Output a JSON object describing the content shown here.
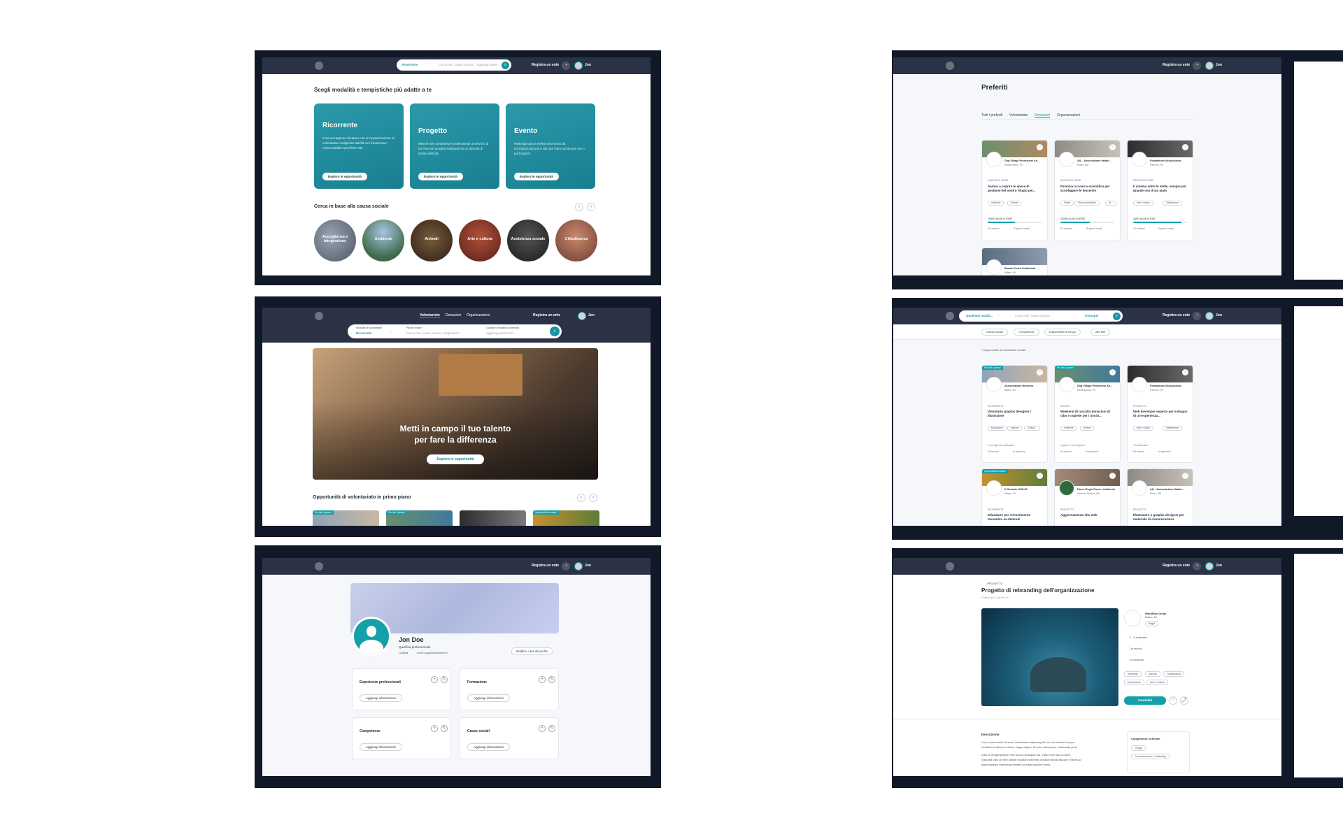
{
  "nav": {
    "register_label": "Registra un ente",
    "user_name": "Jon",
    "chevron": "⌄",
    "bell_icon": "bell-icon",
    "search_icon": "search-icon"
  },
  "screen1": {
    "search": {
      "select_value": "Ricorrente",
      "cause_placeholder": "Cerca enti, cause sociali...",
      "where_placeholder": "Aggiungi prefer..."
    },
    "heading": "Scegli modalità e tempistiche più adatte a te",
    "cards": [
      {
        "title": "Ricorrente",
        "desc": "Crea un rapporto duraturo con un'organizzazione di volontariato svolgendo attività con frequenza e responsabilità specifiche alla",
        "button": "Esplora le opportunità"
      },
      {
        "title": "Progetto",
        "desc": "Metti le tue competenze professionali al servizio di un ente per progetti sviluppati su un periodo di durata definita",
        "button": "Esplora le opportunità"
      },
      {
        "title": "Evento",
        "desc": "Partecipa ad un evento promosso da un'organizzazione e dai una mano ad alcune ore o pochi giorni",
        "button": "Esplora le opportunità"
      }
    ],
    "causes_heading": "Cerca in base alla causa sociale",
    "causes": [
      "Accoglienza e integrazione",
      "Ambiente",
      "Animali",
      "Arte e cultura",
      "Assistenza sociale",
      "Cittadinanza"
    ],
    "prev": "‹",
    "next": "›"
  },
  "screen2": {
    "title": "Preferiti",
    "tabs": [
      "Tutti i preferiti",
      "Volontariato",
      "Donazioni",
      "Organizzazioni"
    ],
    "cards": [
      {
        "org": "Dog Village Protezione An...",
        "loc": "Montesilvano, PE",
        "type": "RACCOLTA FONDI",
        "title": "Aiutaci a coprire le spese di gestione del nostro rifugio per...",
        "tags": [
          "Ambiente",
          "Animali"
        ],
        "amount": "1500€ raccolti di 2000€",
        "progress": 0.5,
        "donors": "23 donatori",
        "days": "12 giorni rimasti"
      },
      {
        "org": "AIL - Associazione Italian...",
        "loc": "Roma, RM",
        "type": "RACCOLTA FONDI",
        "title": "Finanzia la ricerca scientifica per sconfiggere le leucemie",
        "tags": [
          "Salute",
          "Ricerca scientifica",
          "Al..."
        ],
        "amount": "4000€ raccolti di 8000€",
        "progress": 0.55,
        "donors": "83 donatori",
        "days": "18 giorni rimasti"
      },
      {
        "org": "Fondazione Associazion...",
        "loc": "Palermo, PA",
        "type": "RACCOLTA FONDI",
        "title": "Il cinema sotto le stelle, sempre più grande con il tuo aiuto",
        "tags": [
          "Arte e cultura",
          "Cittadinanza"
        ],
        "amount": "450€ raccolti di 500€",
        "progress": 0.9,
        "donors": "14 donatori",
        "days": "5 giorni rimasti"
      },
      {
        "org": "Banda Civica Solidarietà",
        "loc": "Milano, MI"
      }
    ]
  },
  "screen3": {
    "tabs": [
      "Volontariato",
      "Donazioni",
      "Organizzazioni"
    ],
    "search": {
      "mode_label": "Modalità di volontariato",
      "mode_value": "Ricorrente",
      "keyword_label": "Parole chiave",
      "keyword_placeholder": "Cerca enti, cause sociali, competenze",
      "where_label": "Località o modalità da remoto",
      "where_placeholder": "Aggiungi preferenze"
    },
    "hero_title_line1": "Metti in campo il tuo talento",
    "hero_title_line2": "per fare la differenza",
    "hero_button": "Esplora le opportunità",
    "featured_heading": "Opportunità di volontariato in primo piano",
    "badges": [
      "Per tutti i giovani",
      "Per tutti i giovani",
      "",
      "Opportunità formative"
    ]
  },
  "screen4": {
    "search": {
      "mode": "Qualsiasi modal...",
      "keyword": "Cerca enti, cause sociali...",
      "where": "Ovunque"
    },
    "filters": [
      "Causa sociali",
      "Competenze",
      "Disponibilità di tempo",
      "Altri filtri"
    ],
    "count": "7 Opportunità di volontariato trovate",
    "cards": [
      {
        "badge": "Per tutti i giovani",
        "org": "Associazione Mercurio",
        "loc": "Milano, MI",
        "type": "RICORRENTE",
        "title": "Volontario graphic designer / illustratore",
        "tags": [
          "Educazione",
          "Infanzia",
          "Cultura..."
        ],
        "m1": "2 ore ogni due settimane",
        "m2": "Da remoto",
        "m3": "In presenza"
      },
      {
        "badge": "Per tutti i giovani",
        "org": "Dog Village Protezione An...",
        "loc": "Montesilvano, PE",
        "type": "EVENTO",
        "title": "Weekend di raccolta donazioni di cibo e coperte per i nostri...",
        "tags": [
          "Ambiente",
          "Animali"
        ],
        "m1": "2 giorni, 3 ore al giorno",
        "m2": "Da remoto",
        "m3": "In presenza"
      },
      {
        "badge": "",
        "org": "Fondazione Associazion...",
        "loc": "Palermo, PA",
        "type": "PROGETTO",
        "title": "Web developer esperto per sviluppo di un'esperienza...",
        "tags": [
          "Arte e cultura",
          "Cittadinanza"
        ],
        "m1": "4 h settimana",
        "m2": "Da remoto",
        "m3": "In presenza"
      },
      {
        "badge": "Opportunità formative",
        "org": "Il Girasole ONLUS",
        "loc": "Milano, MI",
        "type": "RICORRENTE",
        "title": "Educatore per reinserimento lavorativo ex-detenuti"
      },
      {
        "badge": "",
        "org": "Parco Regio Parco...Ambiente",
        "loc": "Cesena, Ginevra, BN",
        "type": "PROGETTO",
        "title": "Aggiornamento sito web"
      },
      {
        "badge": "",
        "org": "AIL - Associazione Italian...",
        "loc": "Roma, RM",
        "type": "PROGETTO",
        "title": "Illustratore o graphic designer per materiale di comunicazione"
      }
    ]
  },
  "screen5": {
    "name": "Jon Doe",
    "qualification": "Qualifica professionale",
    "location": "Località",
    "email": "nome.cognome@utente.it",
    "edit_button": "Modifica i dati del profilo",
    "sections": [
      {
        "title": "Esperienze professionali",
        "button": "Aggiungi informazioni"
      },
      {
        "title": "Formazione",
        "button": "Aggiungi informazioni"
      },
      {
        "title": "Competenze",
        "button": "Aggiungi informazioni"
      },
      {
        "title": "Cause sociali",
        "button": "Aggiungi informazioni"
      }
    ]
  },
  "screen6": {
    "type": "PROGETTO",
    "title": "Progetto di rebranding dell'organizzazione",
    "published": "Pubblicato 1 giorno fa",
    "org": "Worldlike Onlus",
    "org_loc": "Milano, MI",
    "follow": "Segui",
    "meta": [
      "2 - 6 settimane",
      "Da remoto",
      "In presenza"
    ],
    "tags": [
      "Ambiente",
      "Animali",
      "Cittadinanza",
      "Educazione",
      "Arte e cultura"
    ],
    "apply": "Candidati",
    "desc_heading": "Descrizione",
    "desc_lines": [
      "Lorem ipsum dolor sit amet, consectetur adipiscing elit, sed do eiusmod tempor",
      "incididunt ut labore et dolore magna aliqua. Ut enim ullamcorper malesuada proin.",
      "Odio eu feugiat pretium nibh ipsum consequat nisl. Vitae et leo duis ut diam.",
      "Vulputate odio ut enim blandit volutpat maecenas volutpat blandit aliquam. Fames ac",
      "turpis egestas maecenas pharetra convallis posuere morbi."
    ],
    "skills_heading": "Competenze richieste",
    "skills": [
      "Design",
      "Comunicazione e marketing"
    ]
  },
  "colors": {
    "teal": "#14a0a8",
    "nav": "#2b3245",
    "frame": "#111827"
  }
}
